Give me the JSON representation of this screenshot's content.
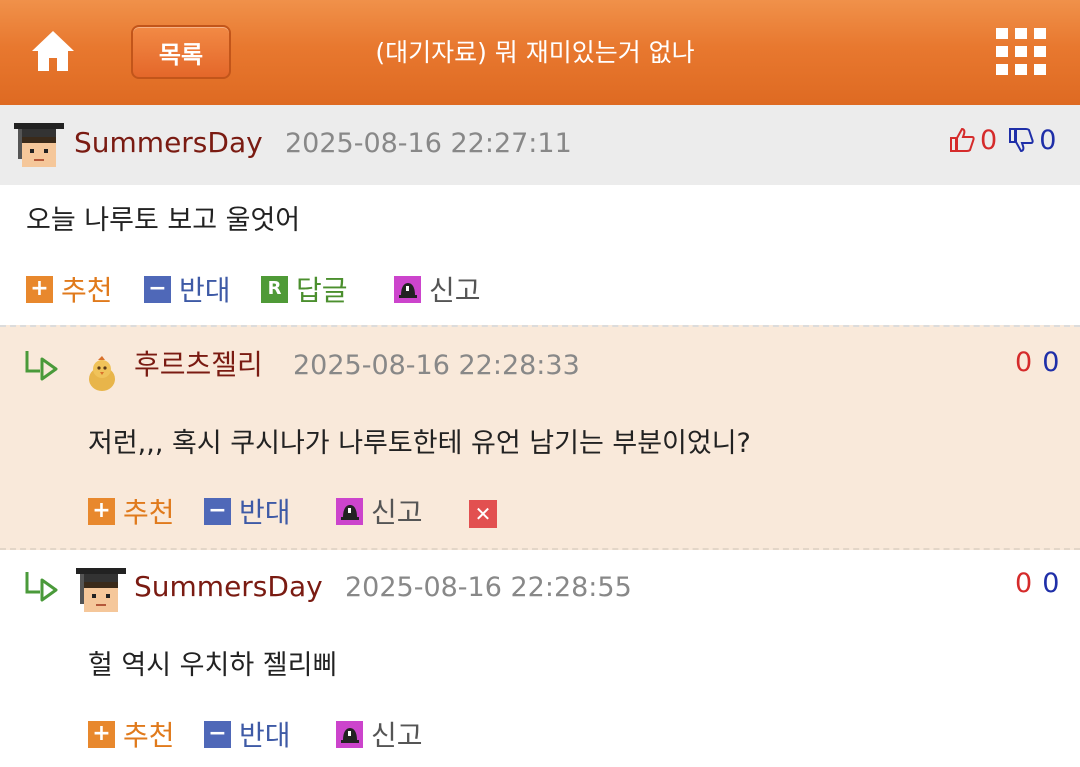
{
  "header": {
    "list_button": "목록",
    "title": "(대기자료) 뭐 재미있는거 없나",
    "bg_color": "#e8782f"
  },
  "icons": {
    "home": "home-icon",
    "grid": "grid-menu-icon",
    "reply_arrow": "reply-arrow-icon",
    "thumbs_up": "thumbs-up-icon",
    "thumbs_down": "thumbs-down-icon",
    "report": "siren-icon",
    "delete": "close-icon"
  },
  "actions": {
    "recommend": "추천",
    "oppose": "반대",
    "reply": "답글",
    "report": "신고",
    "reply_badge": "R",
    "plus_glyph": "+",
    "minus_glyph": "−",
    "delete_glyph": "✕"
  },
  "comments": [
    {
      "username": "SummersDay",
      "timestamp": "2025-08-16 22:27:11",
      "text": "오늘 나루토 보고 울엇어",
      "up": "0",
      "down": "0"
    },
    {
      "username": "후르츠젤리",
      "timestamp": "2025-08-16 22:28:33",
      "text": "저런,,, 혹시 쿠시나가 나루토한테 유언 남기는 부분이었니?",
      "up": "0",
      "down": "0"
    },
    {
      "username": "SummersDay",
      "timestamp": "2025-08-16 22:28:55",
      "text": "헐 역시 우치하 젤리삐",
      "up": "0",
      "down": "0"
    }
  ],
  "colors": {
    "username": "#7a1b12",
    "up_count": "#d52b2b",
    "down_count": "#1f2fa8",
    "reply_highlight_bg": "#f9e9da"
  }
}
